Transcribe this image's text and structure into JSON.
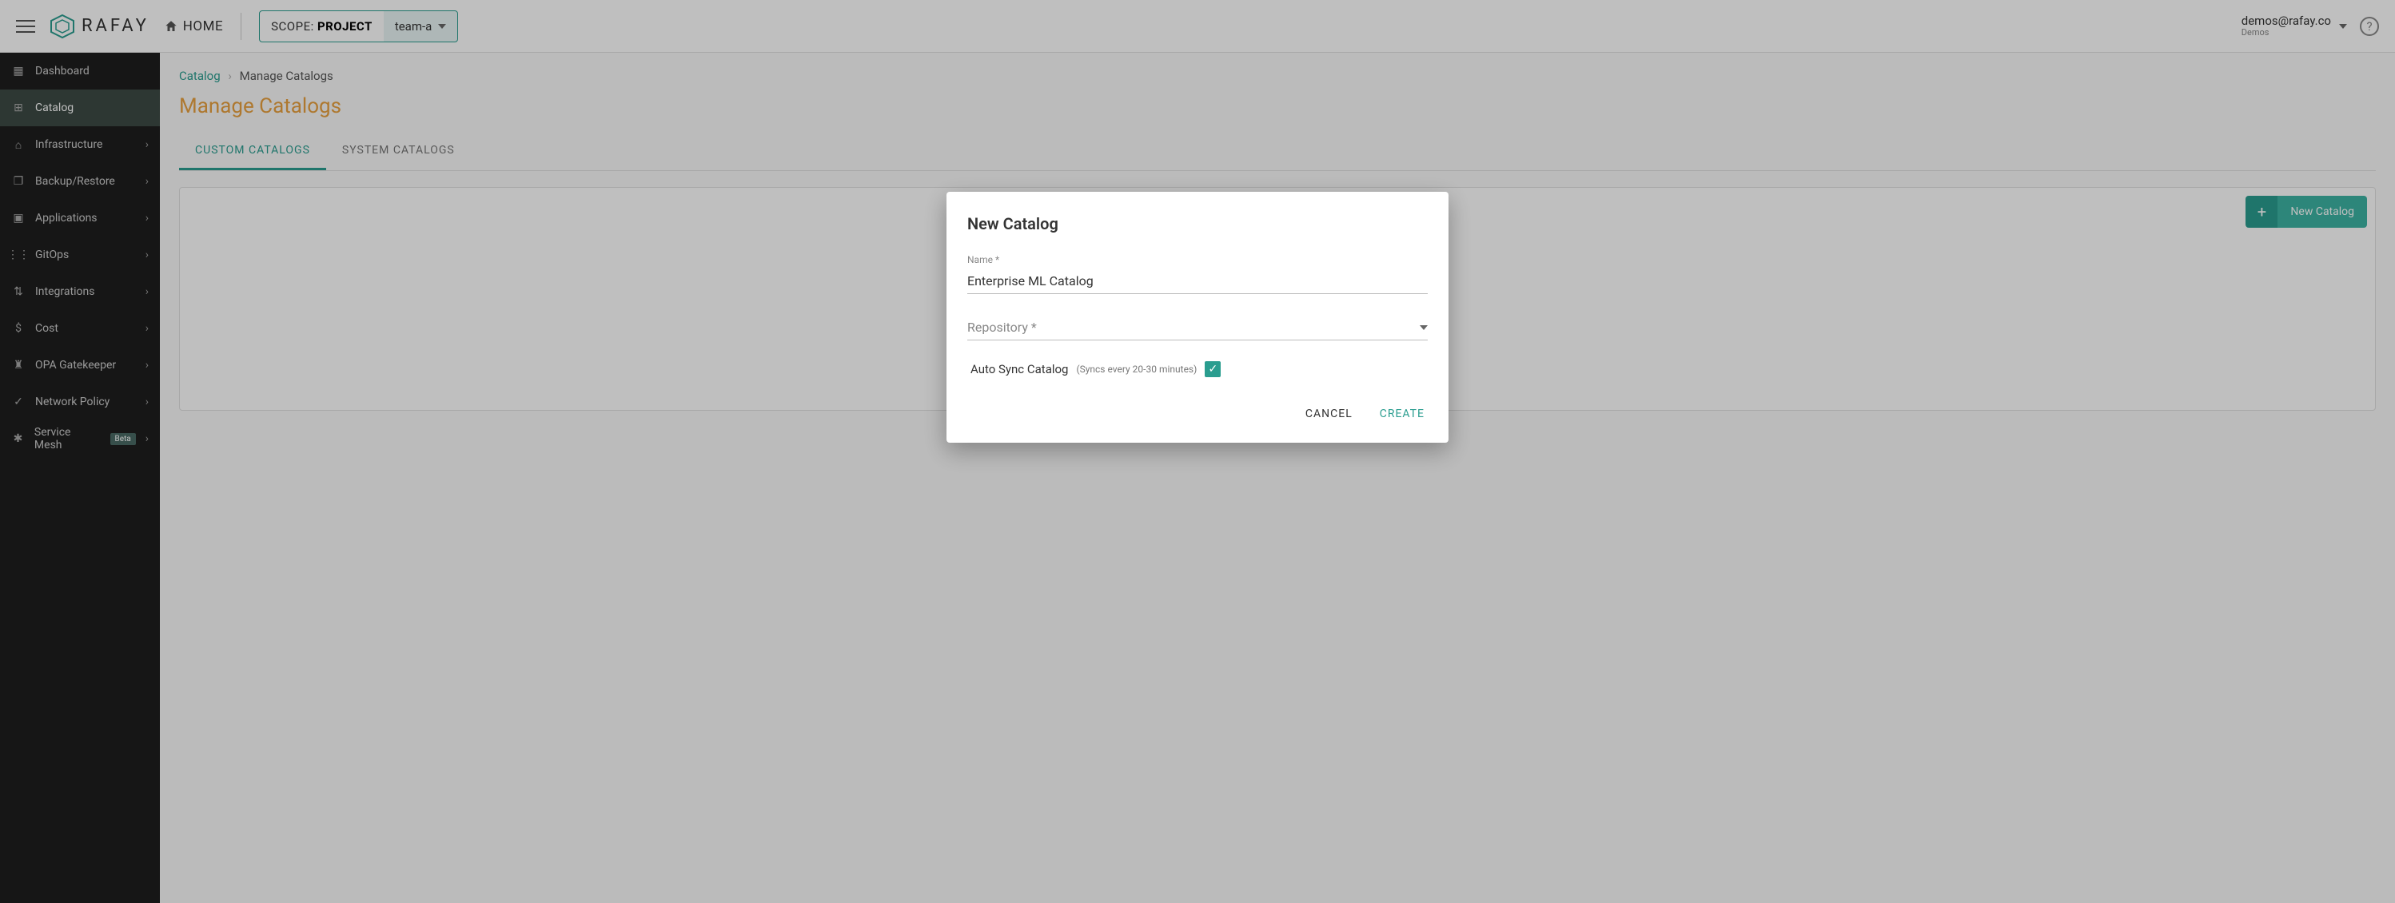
{
  "topbar": {
    "home_label": "HOME",
    "scope_prefix": "SCOPE: ",
    "scope_value": "PROJECT",
    "project_name": "team-a",
    "user_email": "demos@rafay.co",
    "user_org": "Demos",
    "logo_text": "RAFAY"
  },
  "sidebar": {
    "items": [
      {
        "label": "Dashboard",
        "icon": "▦",
        "expandable": false
      },
      {
        "label": "Catalog",
        "icon": "⊞",
        "expandable": false,
        "active": true
      },
      {
        "label": "Infrastructure",
        "icon": "⌂",
        "expandable": true
      },
      {
        "label": "Backup/Restore",
        "icon": "❐",
        "expandable": true
      },
      {
        "label": "Applications",
        "icon": "▣",
        "expandable": true
      },
      {
        "label": "GitOps",
        "icon": "⋮⋮",
        "expandable": true
      },
      {
        "label": "Integrations",
        "icon": "⇅",
        "expandable": true
      },
      {
        "label": "Cost",
        "icon": "$",
        "expandable": true
      },
      {
        "label": "OPA Gatekeeper",
        "icon": "♜",
        "expandable": true
      },
      {
        "label": "Network Policy",
        "icon": "✓",
        "expandable": true
      },
      {
        "label": "Service Mesh",
        "icon": "✱",
        "expandable": true,
        "badge": "Beta"
      }
    ]
  },
  "breadcrumb": {
    "root": "Catalog",
    "sep": "›",
    "current": "Manage Catalogs"
  },
  "page": {
    "title": "Manage Catalogs",
    "tabs": [
      {
        "label": "CUSTOM CATALOGS",
        "active": true
      },
      {
        "label": "SYSTEM CATALOGS",
        "active": false
      }
    ],
    "new_button": "New Catalog"
  },
  "modal": {
    "title": "New Catalog",
    "name_label": "Name *",
    "name_value": "Enterprise ML Catalog",
    "repo_label": "Repository *",
    "autosync_label": "Auto Sync Catalog",
    "autosync_note": "(Syncs every 20-30 minutes)",
    "autosync_checked": true,
    "cancel": "CANCEL",
    "create": "CREATE"
  },
  "colors": {
    "accent": "#2a9d8f",
    "title": "#e8a13f",
    "sidebar_bg": "#1e1e1e"
  }
}
